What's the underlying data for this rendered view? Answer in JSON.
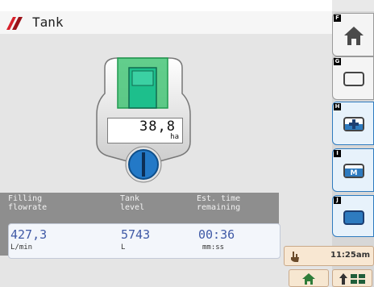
{
  "window": {
    "title": "Tank"
  },
  "tank": {
    "area_value": "38,8",
    "area_unit": "ha"
  },
  "info": {
    "labels": [
      "Filling\nflowrate",
      "Tank\nlevel",
      "Est. time\nremaining"
    ],
    "values": [
      "427,3",
      "5743",
      "00:36"
    ],
    "units": [
      "L/min",
      "L",
      "mm:ss"
    ]
  },
  "softkeys": [
    {
      "tag": "F",
      "icon": "home-icon"
    },
    {
      "tag": "G",
      "icon": "tank-empty-icon"
    },
    {
      "tag": "H",
      "icon": "tank-plus-icon"
    },
    {
      "tag": "I",
      "icon": "tank-m-icon"
    },
    {
      "tag": "J",
      "icon": "tank-full-icon"
    }
  ],
  "status": {
    "time": "11:25am"
  },
  "colors": {
    "accent_blue": "#2e7bbf",
    "value_blue": "#3f59a6",
    "tank_green": "#2ebd66",
    "brand_red": "#d7212b"
  }
}
